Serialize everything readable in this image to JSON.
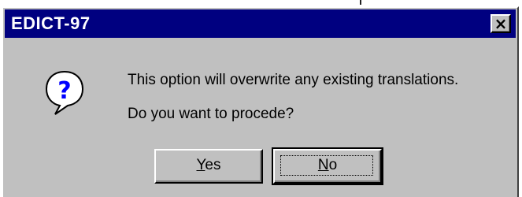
{
  "window": {
    "title": "EDICT-97",
    "close_glyph": "×"
  },
  "message": {
    "icon": "question-icon",
    "line1": "This option will overwrite any existing translations.",
    "line2": "Do you want to procede?"
  },
  "buttons": {
    "yes_mnemonic": "Y",
    "yes_rest": "es",
    "no_mnemonic": "N",
    "no_rest": "o"
  },
  "colors": {
    "titlebar": "#000080",
    "face": "#c0c0c0",
    "icon_bubble": "#ffffff",
    "icon_glyph": "#0000ff"
  }
}
